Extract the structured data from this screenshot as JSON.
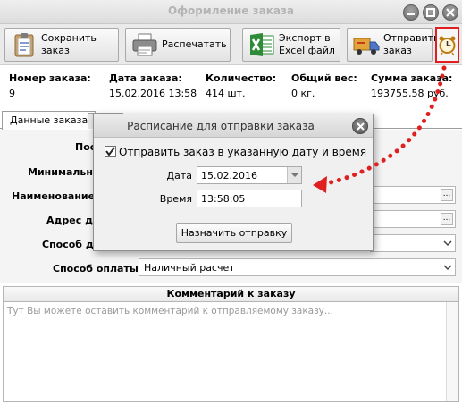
{
  "window": {
    "title": "Оформление заказа"
  },
  "toolbar": {
    "save_label_1": "Сохранить",
    "save_label_2": "заказ",
    "print_label": "Распечатать",
    "export_label_1": "Экспорт в",
    "export_label_2": "Excel файл",
    "send_label_1": "Отправить",
    "send_label_2": "заказ"
  },
  "summary": {
    "order_number_label": "Номер заказа:",
    "order_number_value": "9",
    "date_label": "Дата заказа:",
    "date_value": "15.02.2016 13:58",
    "quantity_label": "Количество:",
    "quantity_value": "414 шт.",
    "weight_label": "Общий вес:",
    "weight_value": "0 кг.",
    "sum_label": "Сумма заказа:",
    "sum_value": "193755,58 руб."
  },
  "tabs": [
    {
      "label": "Данные заказа"
    }
  ],
  "form": {
    "field1_label": "Пос",
    "field2_label": "Минимальн",
    "field3_label": "Наименование",
    "field4_label": "Адрес д",
    "field5_label": "Способ д",
    "payment_label": "Способ оплаты",
    "payment_value": "Наличный расчет"
  },
  "comment": {
    "header": "Комментарий к заказу",
    "placeholder": "Тут Вы можете оставить комментарий к отправляемому заказу..."
  },
  "dialog": {
    "title": "Расписание для отправки заказа",
    "checkbox_label": "Отправить заказ в указанную дату и время",
    "checkbox_checked": true,
    "date_label": "Дата",
    "date_value": "15.02.2016",
    "time_label": "Время",
    "time_value": "13:58:05",
    "button_label": "Назначить отправку"
  },
  "colors": {
    "highlight_red": "#e02020",
    "excel_green": "#2e8b3a"
  },
  "icons": {
    "save": "clipboard-save-icon",
    "print": "printer-icon",
    "export": "excel-icon",
    "send": "truck-icon",
    "schedule": "alarm-clock-icon"
  }
}
